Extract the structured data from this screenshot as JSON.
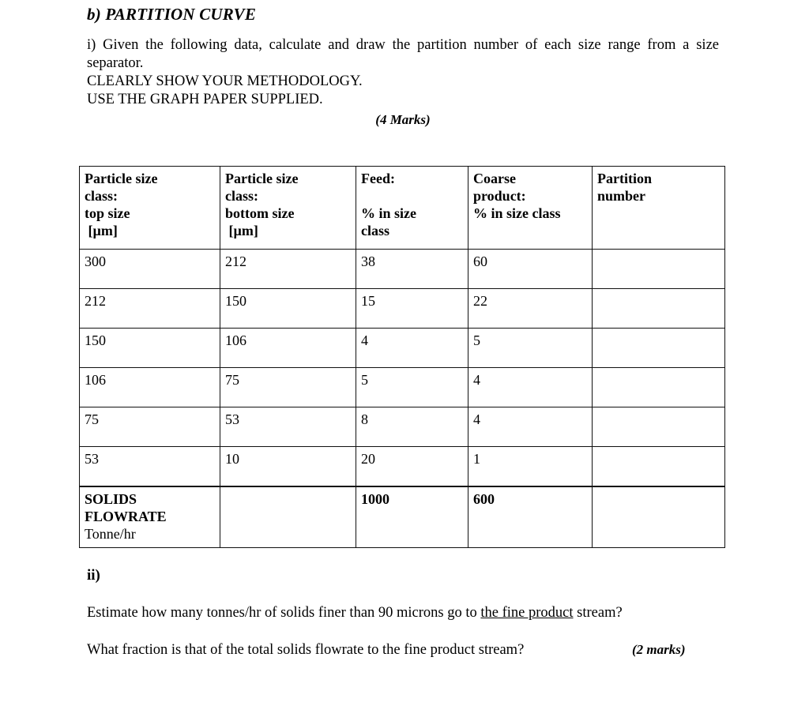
{
  "heading": "b) PARTITION CURVE",
  "intro": {
    "paragraph": "i) Given the following data, calculate and draw the partition number of each size range from a size separator.",
    "line2": "CLEARLY SHOW YOUR METHODOLOGY.",
    "line3": "USE THE GRAPH PAPER SUPPLIED.",
    "marks": "(4 Marks)"
  },
  "table": {
    "headers": [
      {
        "lines": [
          "Particle size",
          "class:",
          "top size",
          " [µm]"
        ]
      },
      {
        "lines": [
          "Particle size",
          "class:",
          "bottom size",
          " [µm]"
        ]
      },
      {
        "lines": [
          "Feed:",
          "",
          "% in size",
          "class"
        ]
      },
      {
        "lines": [
          "Coarse",
          "product:",
          "% in size class"
        ]
      },
      {
        "lines": [
          "Partition",
          "number"
        ]
      }
    ],
    "rows": [
      {
        "top_size": "300",
        "bottom_size": "212",
        "feed_pct": "38",
        "coarse_pct": "60",
        "partition_number": ""
      },
      {
        "top_size": "212",
        "bottom_size": "150",
        "feed_pct": "15",
        "coarse_pct": "22",
        "partition_number": ""
      },
      {
        "top_size": "150",
        "bottom_size": "106",
        "feed_pct": "4",
        "coarse_pct": "5",
        "partition_number": ""
      },
      {
        "top_size": "106",
        "bottom_size": "75",
        "feed_pct": "5",
        "coarse_pct": "4",
        "partition_number": ""
      },
      {
        "top_size": "75",
        "bottom_size": "53",
        "feed_pct": "8",
        "coarse_pct": "4",
        "partition_number": ""
      },
      {
        "top_size": "53",
        "bottom_size": "10",
        "feed_pct": "20",
        "coarse_pct": "1",
        "partition_number": ""
      }
    ],
    "total_row": {
      "label_line1": "SOLIDS",
      "label_line2": "FLOWRATE",
      "label_line3": "Tonne/hr",
      "bottom_size": "",
      "feed_total": "1000",
      "coarse_total": "600",
      "partition_number": ""
    }
  },
  "part_ii": {
    "label": "ii)",
    "question1_before": "Estimate how many tonnes/hr of solids finer than 90 microns go to ",
    "question1_underlined": "the fine product",
    "question1_after": " stream?",
    "question2": "What fraction is that of the total solids flowrate to the fine product stream?",
    "marks": "(2 marks)"
  }
}
